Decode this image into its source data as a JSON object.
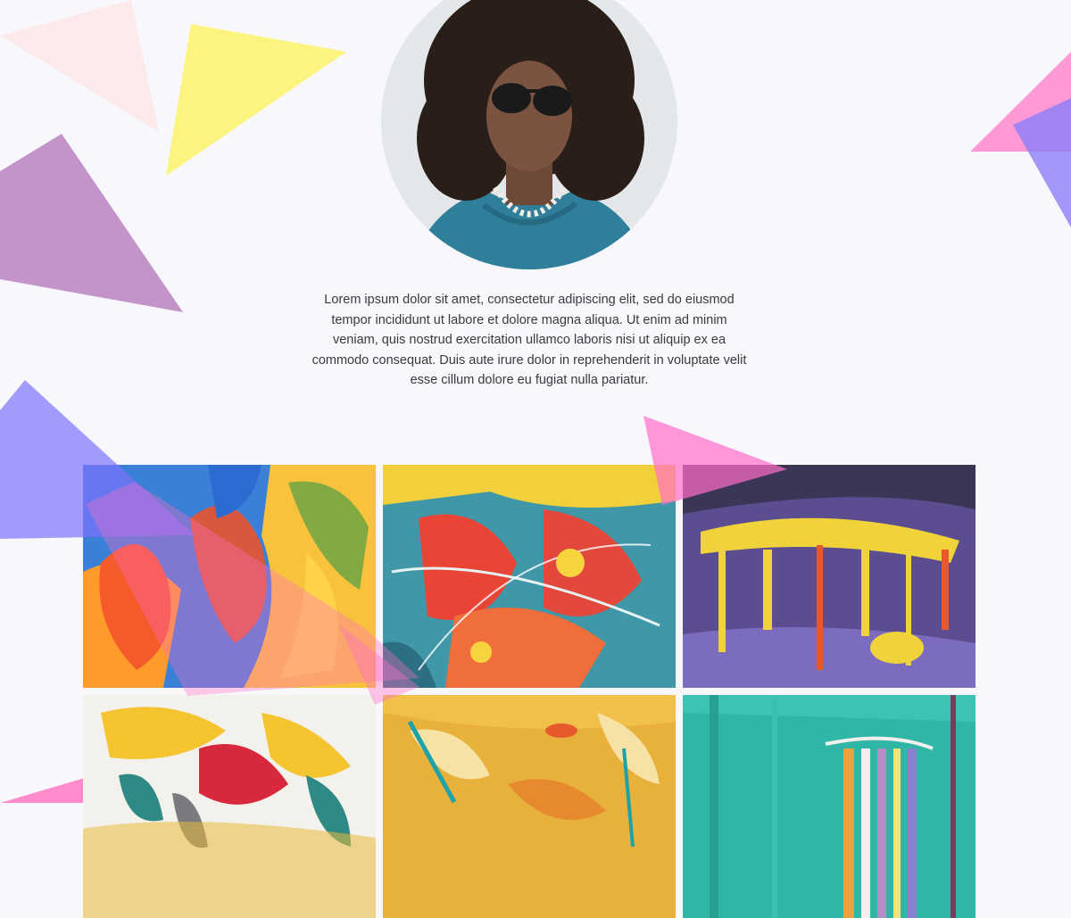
{
  "profile": {
    "photo_alt": "Portrait of a man with curly hair and sunglasses"
  },
  "bio": {
    "text": "Lorem ipsum dolor sit amet, consectetur adipiscing elit, sed do eiusmod tempor incididunt ut labore et dolore magna aliqua. Ut enim ad minim veniam, quis nostrud exercitation ullamco laboris nisi ut aliquip ex ea commodo consequat. Duis aute irure dolor in reprehenderit in voluptate velit esse cillum dolore eu fugiat nulla pariatur."
  },
  "gallery": {
    "items": [
      {
        "alt": "Abstract painting in blue, orange and yellow"
      },
      {
        "alt": "Abstract painting in teal, red and yellow splatter"
      },
      {
        "alt": "Abstract painting in purple with yellow drips"
      },
      {
        "alt": "Abstract painting with red, yellow and teal brush strokes on white"
      },
      {
        "alt": "Abstract painting in golden yellow with orange"
      },
      {
        "alt": "Abstract painting in turquoise with colorful streaks"
      }
    ]
  },
  "colors": {
    "background": "#f8f8fc",
    "text": "#3a3a3a",
    "pink": "#ff6ec7",
    "yellow": "#fbf56a",
    "lilac": "#b57abd",
    "violet": "#7c74fb",
    "peach": "#fde8e8"
  }
}
